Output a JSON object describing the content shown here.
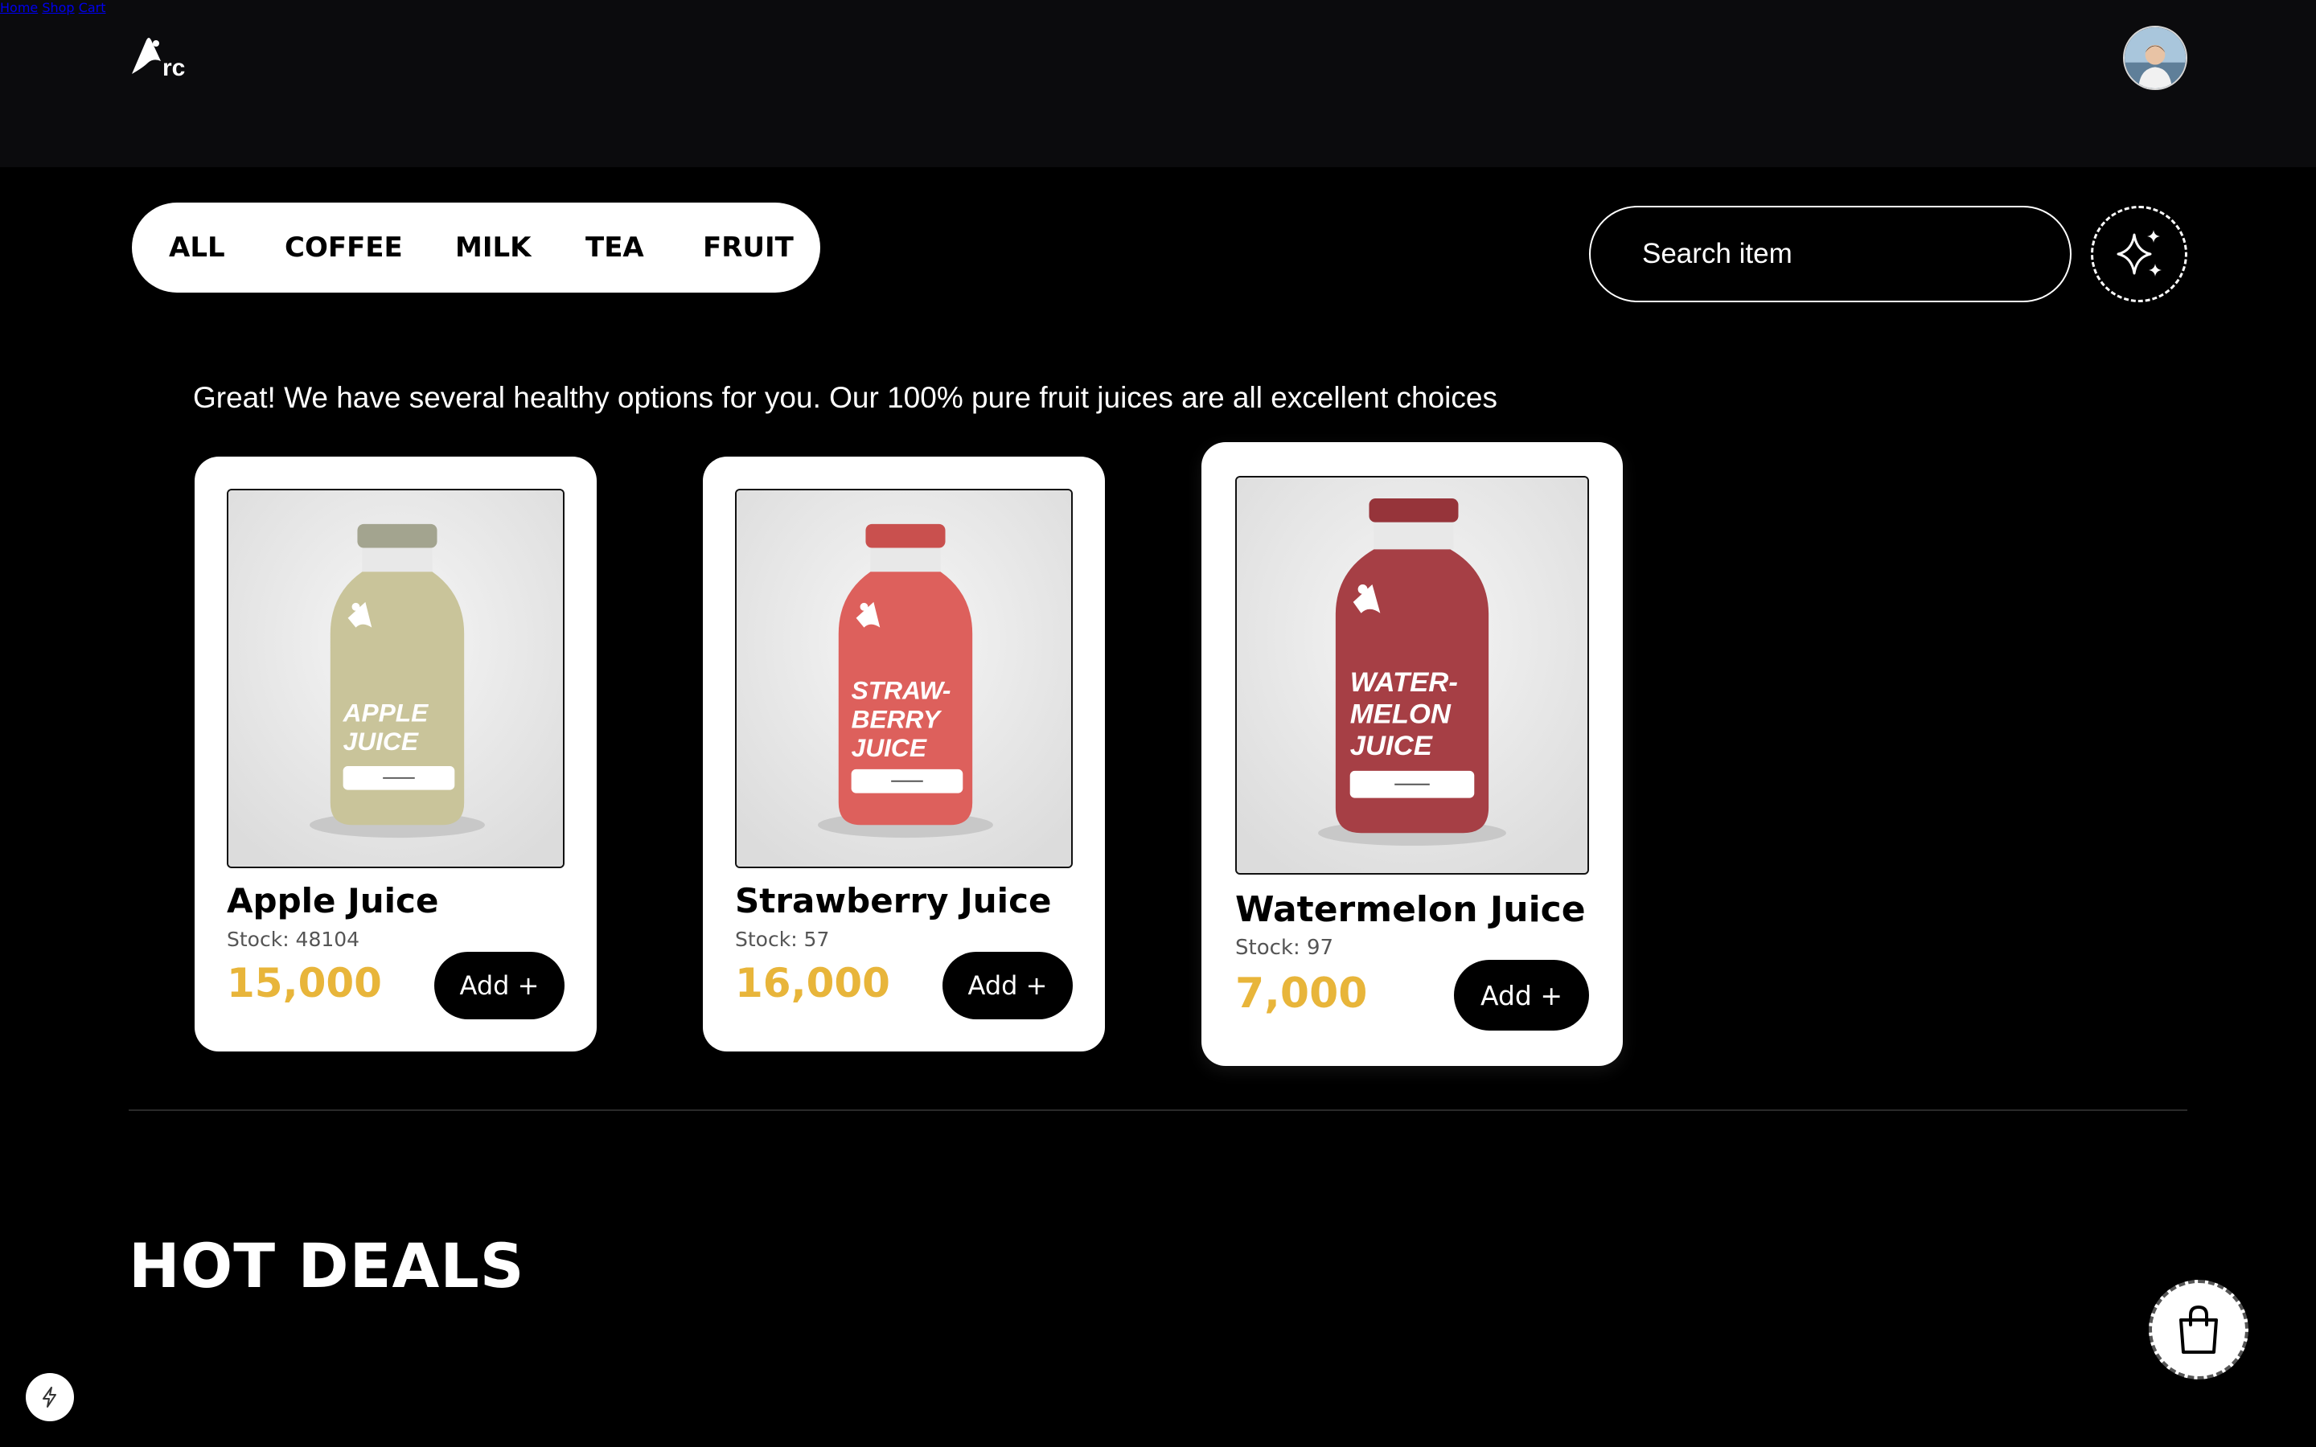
{
  "header": {
    "logo_text": "Arc",
    "nav": [
      {
        "label": "Home"
      },
      {
        "label": "Shop"
      },
      {
        "label": "Cart"
      }
    ]
  },
  "filters": {
    "items": [
      {
        "label": "ALL"
      },
      {
        "label": "COFFEE"
      },
      {
        "label": "MILK"
      },
      {
        "label": "TEA"
      },
      {
        "label": "FRUIT"
      }
    ]
  },
  "search": {
    "placeholder": "Search item"
  },
  "recommendation": {
    "message": "Great! We have several healthy options for you. Our 100% pure fruit juices are all excellent choices"
  },
  "products": [
    {
      "name": "Apple Juice",
      "stock": "Stock: 48104",
      "price": "15,000",
      "add_label": "Add +",
      "label_lines": [
        "APPLE",
        "JUICE"
      ],
      "bottle_color": "#c9c49a",
      "cap_color": "#a3a48f"
    },
    {
      "name": "Strawberry Juice",
      "stock": "Stock: 57",
      "price": "16,000",
      "add_label": "Add +",
      "label_lines": [
        "STRAW-",
        "BERRY",
        "JUICE"
      ],
      "bottle_color": "#dd605c",
      "cap_color": "#c9504e"
    },
    {
      "name": "Watermelon Juice",
      "stock": "Stock: 97",
      "price": "7,000",
      "add_label": "Add +",
      "label_lines": [
        "WATER-",
        "MELON",
        "JUICE"
      ],
      "bottle_color": "#a63f45",
      "cap_color": "#96343a"
    }
  ],
  "hot_deals": {
    "title": "HOT DEALS"
  },
  "colors": {
    "accent_price": "#e8b53a",
    "background": "#000000",
    "header_bg": "#0b0b0d"
  }
}
